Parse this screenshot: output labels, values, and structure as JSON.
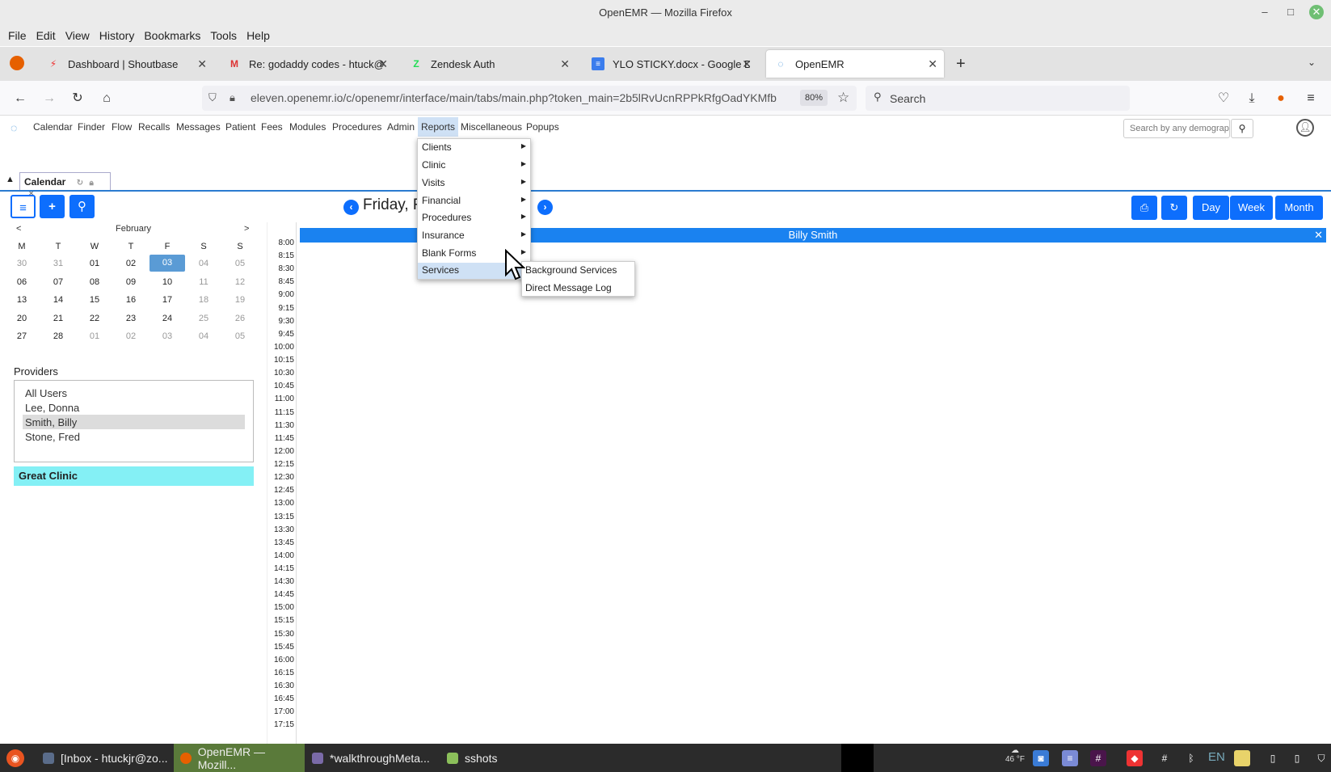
{
  "window": {
    "title": "OpenEMR — Mozilla Firefox"
  },
  "menubar": {
    "items": [
      "File",
      "Edit",
      "View",
      "History",
      "Bookmarks",
      "Tools",
      "Help"
    ]
  },
  "tabs": [
    {
      "label": "Dashboard | Shoutbase"
    },
    {
      "label": "Re: godaddy codes - htuck@"
    },
    {
      "label": "Zendesk Auth"
    },
    {
      "label": "YLO STICKY.docx - Google D"
    },
    {
      "label": "OpenEMR"
    }
  ],
  "nav": {
    "url": "eleven.openemr.io/c/openemr/interface/main/tabs/main.php?token_main=2b5lRvUcnRPPkRfgOadYKMfb",
    "zoom": "80%",
    "search_placeholder": "Search"
  },
  "app_nav": {
    "items": [
      "Calendar",
      "Finder",
      "Flow",
      "Recalls",
      "Messages",
      "Patient",
      "Fees",
      "Modules",
      "Procedures",
      "Admin",
      "Reports",
      "Miscellaneous",
      "Popups"
    ],
    "search_placeholder": "Search by any demographics"
  },
  "calendar_tab": {
    "label": "Calendar"
  },
  "minical": {
    "month": "February",
    "prev": "<",
    "next": ">",
    "weekdays": [
      "M",
      "T",
      "W",
      "T",
      "F",
      "S",
      "S"
    ],
    "weeks": [
      [
        "30",
        "31",
        "01",
        "02",
        "03",
        "04",
        "05"
      ],
      [
        "06",
        "07",
        "08",
        "09",
        "10",
        "11",
        "12"
      ],
      [
        "13",
        "14",
        "15",
        "16",
        "17",
        "18",
        "19"
      ],
      [
        "20",
        "21",
        "22",
        "23",
        "24",
        "25",
        "26"
      ],
      [
        "27",
        "28",
        "01",
        "02",
        "03",
        "04",
        "05"
      ]
    ]
  },
  "providers": {
    "label": "Providers",
    "items": [
      "All Users",
      "Lee, Donna",
      "Smith, Billy",
      "Stone, Fred"
    ],
    "selected": "Smith, Billy"
  },
  "facility": "Great Clinic",
  "day_header": "Friday, F",
  "event_header": "Billy Smith",
  "view_buttons": [
    "Day",
    "Week",
    "Month"
  ],
  "times": [
    "8:00",
    "8:15",
    "8:30",
    "8:45",
    "9:00",
    "9:15",
    "9:30",
    "9:45",
    "10:00",
    "10:15",
    "10:30",
    "10:45",
    "11:00",
    "11:15",
    "11:30",
    "11:45",
    "12:00",
    "12:15",
    "12:30",
    "12:45",
    "13:00",
    "13:15",
    "13:30",
    "13:45",
    "14:00",
    "14:15",
    "14:30",
    "14:45",
    "15:00",
    "15:15",
    "15:30",
    "15:45",
    "16:00",
    "16:15",
    "16:30",
    "16:45",
    "17:00",
    "17:15"
  ],
  "reports_menu": [
    "Clients",
    "Clinic",
    "Visits",
    "Financial",
    "Procedures",
    "Insurance",
    "Blank Forms",
    "Services"
  ],
  "services_submenu": [
    "Background Services",
    "Direct Message Log"
  ],
  "taskbar": {
    "items": [
      "[Inbox - htuckjr@zo...",
      "OpenEMR — Mozill...",
      "*walkthroughMeta...",
      "sshots"
    ],
    "weather": "46 °F",
    "lang": "EN"
  },
  "colors": {
    "accent": "#0d6efd",
    "event_bar": "#1a82f0",
    "facility_bg": "#84f0f5",
    "menu_highlight": "#cfe1f5"
  }
}
